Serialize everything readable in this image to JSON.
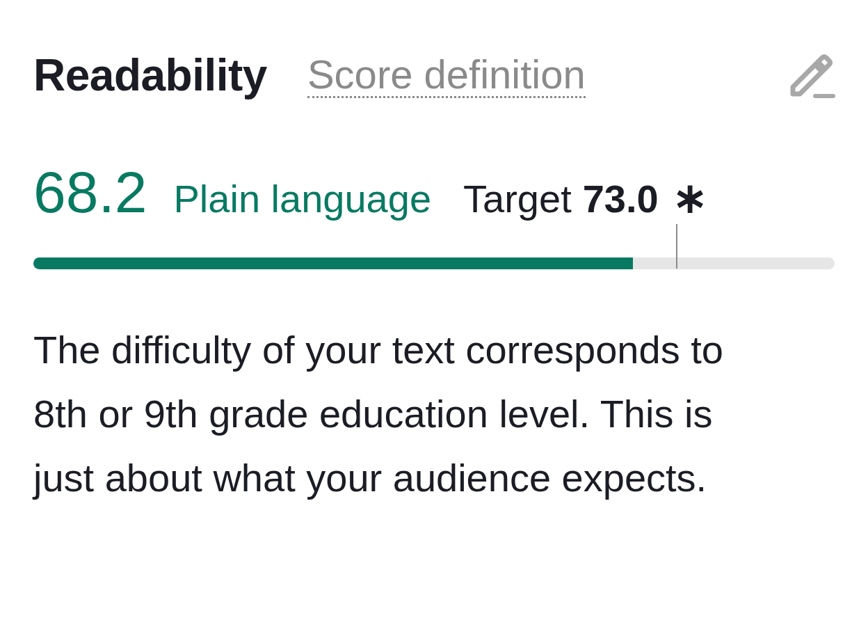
{
  "header": {
    "title": "Readability",
    "link": "Score definition"
  },
  "score": {
    "value": "68.2",
    "label": "Plain language",
    "target_label": "Target",
    "target_value": "73.0",
    "target_mark": "∗"
  },
  "progress": {
    "level": 0.748
  },
  "target_marker": {
    "level": 0.802
  },
  "description": "The difficulty of your text corresponds to 8th or 9th grade education level. This is just about what your audience expects."
}
